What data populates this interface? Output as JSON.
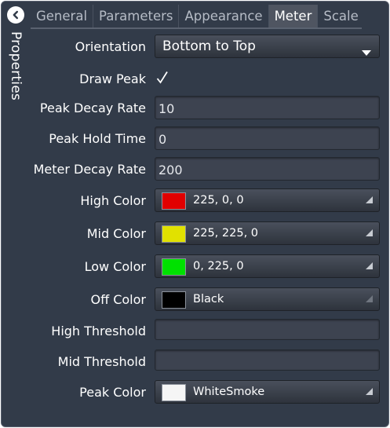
{
  "side_panel": {
    "label": "Properties",
    "back_icon": "chevron-left-icon"
  },
  "tabs": [
    {
      "label": "General",
      "active": false
    },
    {
      "label": "Parameters",
      "active": false
    },
    {
      "label": "Appearance",
      "active": false
    },
    {
      "label": "Meter",
      "active": true
    },
    {
      "label": "Scale",
      "active": false
    }
  ],
  "properties": {
    "orientation": {
      "label": "Orientation",
      "value": "Bottom to Top"
    },
    "draw_peak": {
      "label": "Draw Peak",
      "checked": true
    },
    "peak_decay_rate": {
      "label": "Peak Decay Rate",
      "value": "10"
    },
    "peak_hold_time": {
      "label": "Peak Hold Time",
      "value": "0"
    },
    "meter_decay_rate": {
      "label": "Meter Decay Rate",
      "value": "200"
    },
    "high_color": {
      "label": "High Color",
      "value": "225, 0, 0",
      "swatch": "#e10000"
    },
    "mid_color": {
      "label": "Mid Color",
      "value": "225, 225, 0",
      "swatch": "#e1e100"
    },
    "low_color": {
      "label": "Low Color",
      "value": "0, 225, 0",
      "swatch": "#00e100"
    },
    "off_color": {
      "label": "Off Color",
      "value": "Black",
      "swatch": "#000000"
    },
    "high_threshold": {
      "label": "High Threshold",
      "value": ""
    },
    "mid_threshold": {
      "label": "Mid Threshold",
      "value": ""
    },
    "peak_color": {
      "label": "Peak Color",
      "value": "WhiteSmoke",
      "swatch": "#f5f5f5"
    }
  },
  "colors": {
    "panel_bg": "#323b49",
    "active_tab_bg": "#4f5561"
  }
}
